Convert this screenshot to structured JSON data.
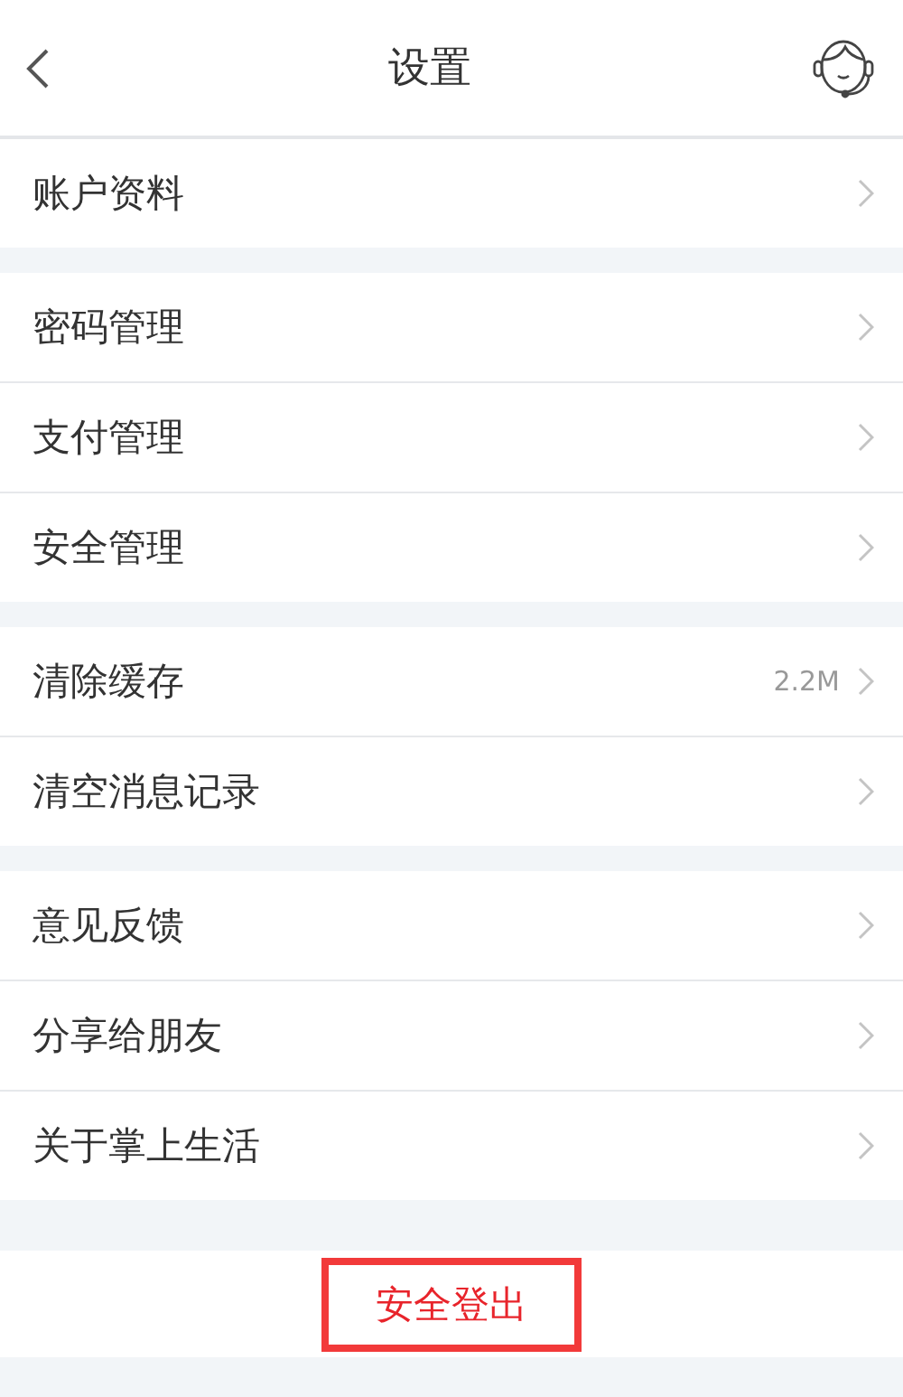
{
  "header": {
    "title": "设置"
  },
  "groups": [
    {
      "items": [
        {
          "label": "账户资料"
        }
      ]
    },
    {
      "items": [
        {
          "label": "密码管理"
        },
        {
          "label": "支付管理"
        },
        {
          "label": "安全管理"
        }
      ]
    },
    {
      "items": [
        {
          "label": "清除缓存",
          "value": "2.2M"
        },
        {
          "label": "清空消息记录"
        }
      ]
    },
    {
      "items": [
        {
          "label": "意见反馈"
        },
        {
          "label": "分享给朋友"
        },
        {
          "label": "关于掌上生活"
        }
      ]
    }
  ],
  "logout": {
    "label": "安全登出",
    "highlighted": true
  }
}
